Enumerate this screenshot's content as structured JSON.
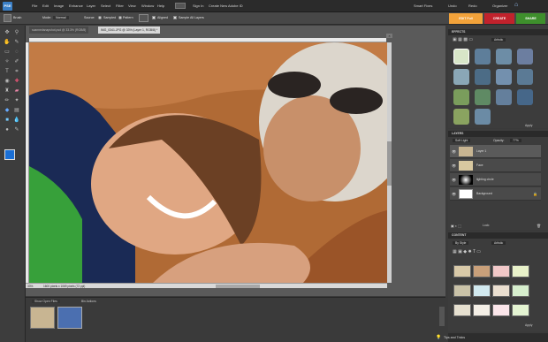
{
  "app": {
    "logo": "PSE"
  },
  "menu": [
    "File",
    "Edit",
    "Image",
    "Enhance",
    "Layer",
    "Select",
    "Filter",
    "View",
    "Window",
    "Help"
  ],
  "topbar": {
    "sign_in": "Sign In",
    "create_id": "Create New Adobe ID",
    "partner": "Smart Fixes",
    "links": "Undo",
    "redo": "Redo",
    "organizer": "Organizer"
  },
  "options": {
    "tool": "Brush",
    "mode_label": "Mode:",
    "mode_value": "Normal",
    "source_label": "Source:",
    "sampled": "Sampled",
    "pattern": "Pattern",
    "aligned": "Aligned",
    "sample_all": "Sample All Layers"
  },
  "mode_tabs": {
    "edit": "EDIT Full",
    "create": "CREATE",
    "share": "SHARE"
  },
  "documents": {
    "tab1": "scannedsnapshot.psd @ 33.3% (RGB/8)",
    "tab2": "IMG_0341.JPG @ 33% (Layer 1, RGB/8) *",
    "status_zoom": "33%",
    "status_size": "1600 pixels x 1069 pixels (72 ppi)"
  },
  "bin": {
    "show": "Show Open Files",
    "label": "Bin Actions"
  },
  "effects": {
    "title": "EFFECTS",
    "filter": "Artistic",
    "apply": "Apply"
  },
  "layers": {
    "title": "LAYERS",
    "blend": "Soft Light",
    "opacity_label": "Opacity:",
    "opacity_value": "77%",
    "lock": "Lock:",
    "items": [
      {
        "name": "Layer 1"
      },
      {
        "name": "Face"
      },
      {
        "name": "lighting circle"
      },
      {
        "name": "Background"
      }
    ]
  },
  "content": {
    "title": "CONTENT",
    "by": "By Style",
    "filter": "Artistic",
    "apply": "Apply"
  },
  "footer": {
    "tips": "Tips and Tricks"
  },
  "colors": {
    "accent": "#f2a23a",
    "create": "#c1222c",
    "share": "#3e8f2c",
    "fg": "#1a6fd6"
  }
}
